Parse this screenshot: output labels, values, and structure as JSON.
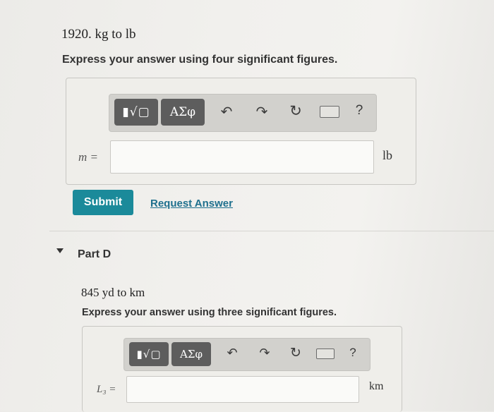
{
  "part_c": {
    "problem": "1920. kg to lb",
    "instruction": "Express your answer using four significant figures.",
    "toolbar": {
      "templates_label": "▮√▢",
      "greek_label": "ΑΣφ",
      "undo_icon": "undo-icon",
      "redo_icon": "redo-icon",
      "reset_icon": "reset-icon",
      "keyboard_icon": "keyboard-icon",
      "help_label": "?"
    },
    "variable_label": "m =",
    "input_value": "",
    "unit": "lb",
    "submit_label": "Submit",
    "request_answer_label": "Request Answer"
  },
  "part_d": {
    "header": "Part D",
    "problem": "845 yd to km",
    "instruction": "Express your answer using three significant figures.",
    "toolbar": {
      "templates_label": "▮√▢",
      "greek_label": "ΑΣφ",
      "help_label": "?"
    },
    "variable_label": "L₃ =",
    "input_value": "",
    "unit": "km"
  }
}
